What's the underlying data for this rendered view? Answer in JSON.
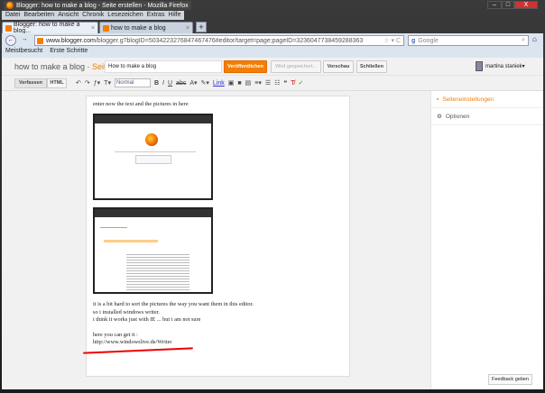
{
  "window": {
    "title": "Blogger: how to make a blog - Seite erstellen - Mozilla Firefox",
    "controls": [
      "–",
      "□",
      "X"
    ]
  },
  "menu": [
    "Datei",
    "Bearbeiten",
    "Ansicht",
    "Chronik",
    "Lesezeichen",
    "Extras",
    "Hilfe"
  ],
  "tabs": [
    {
      "label": "Blogger: how to make a blog..."
    },
    {
      "label": "how to make a blog"
    }
  ],
  "url": {
    "domain": "www.blogger.com",
    "path": "/blogger.g?blogID=5034223276847467476#editor/target=page;pageID=3236047738459288363"
  },
  "search": {
    "placeholder": "Google"
  },
  "bookmarks": [
    "Meistbesucht",
    "Erste Schritte"
  ],
  "blogger": {
    "blog_title": "how to make a blog",
    "type": "Seite",
    "separator": " · ",
    "page_title": "How to make a blog",
    "publish": "Veröffentlichen",
    "saving": "Wird gespeichert...",
    "preview": "Vorschau",
    "close": "Schließen",
    "user": "martina staniek▾"
  },
  "toolbar": {
    "compose": "Verfassen",
    "html": "HTML",
    "format": "Normal",
    "link": "Link"
  },
  "content": {
    "lines": [
      "enter now the text and the pictures in here"
    ],
    "after": [
      "it is a bit hard to sort the pictures the way you want them in this editor.",
      "so i installed windows writer.",
      "i think it works just with IE ... but i am not sure"
    ],
    "here": "here you can get it :",
    "link": "http://www.windowslive.de/Writer"
  },
  "sidebar": {
    "page_settings": "Seiteneinstellungen",
    "options": "Optionen"
  },
  "feedback": "Feedback geben"
}
